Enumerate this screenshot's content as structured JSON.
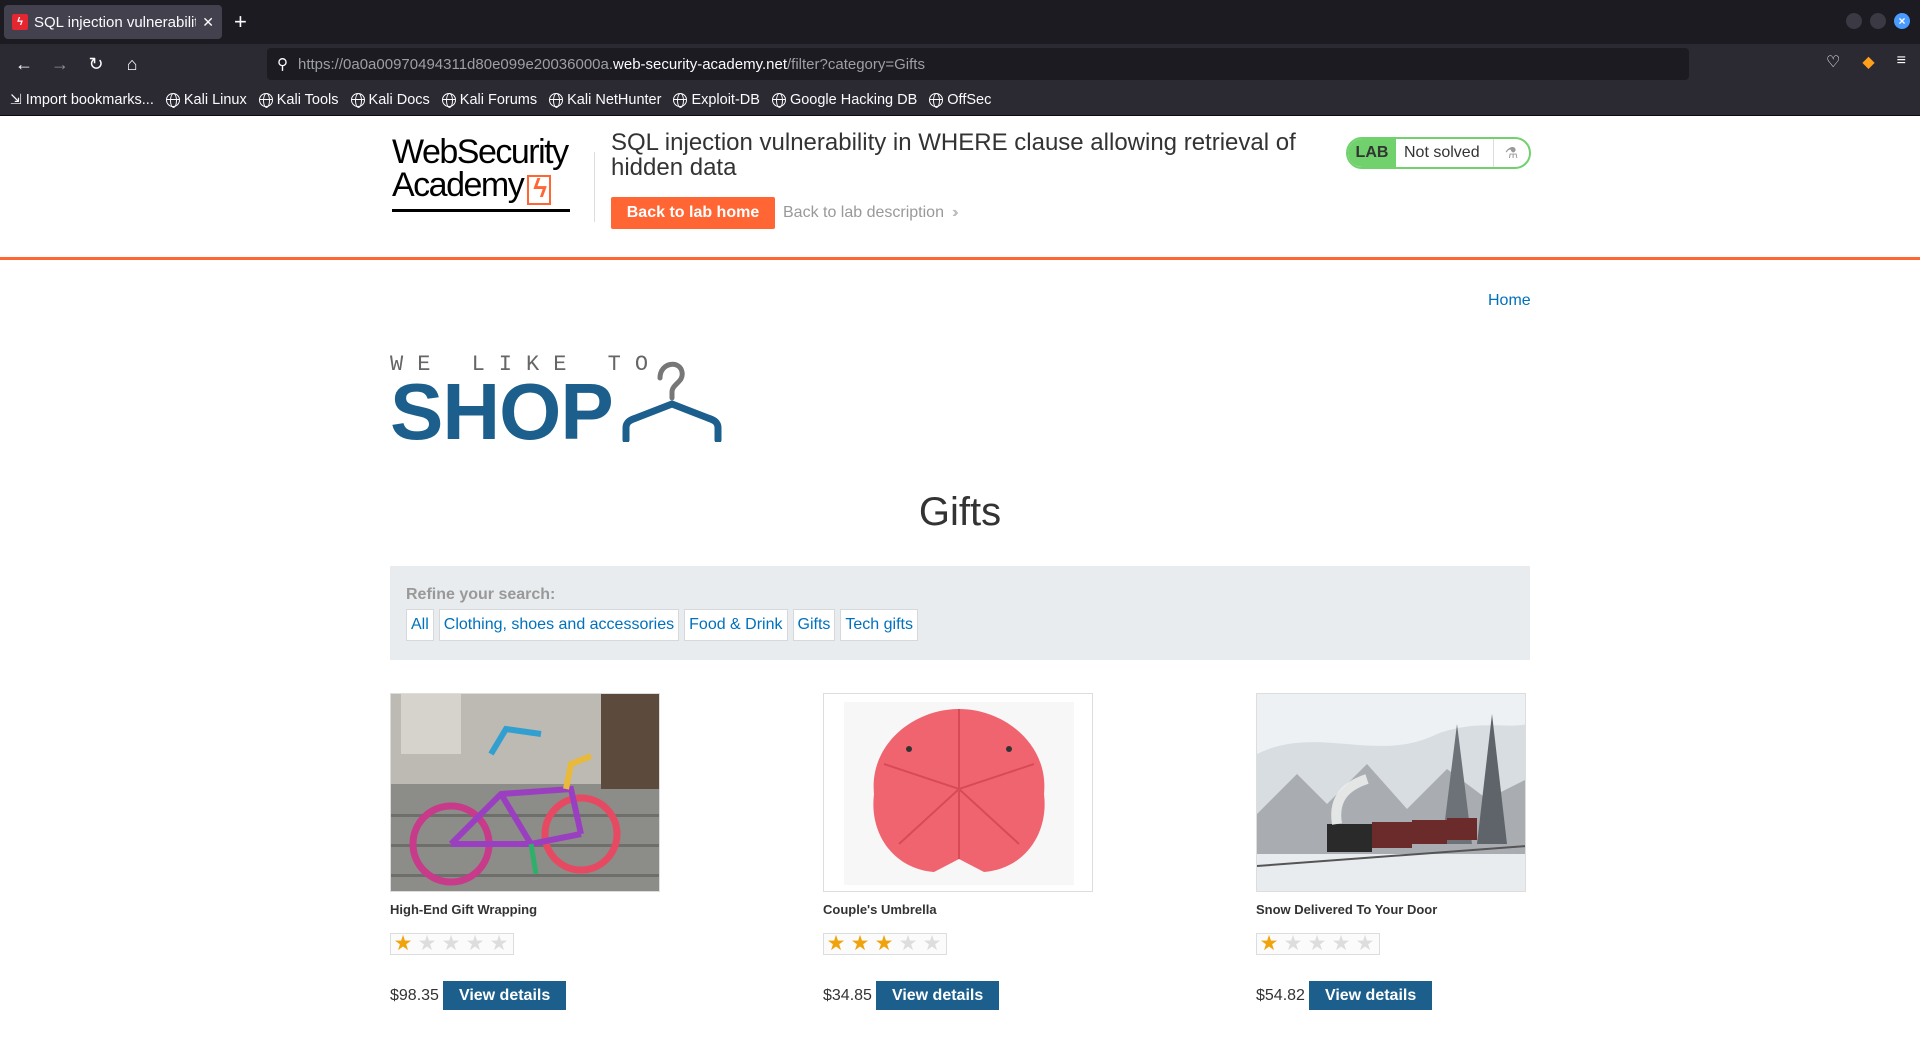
{
  "browser": {
    "tab_title": "SQL injection vulnerability",
    "url_prefix": "https://0a0a00970494311d80e099e20036000a.",
    "url_domain": "web-security-academy.net",
    "url_path": "/filter?category=Gifts",
    "bookmarks": [
      "Import bookmarks...",
      "Kali Linux",
      "Kali Tools",
      "Kali Docs",
      "Kali Forums",
      "Kali NetHunter",
      "Exploit-DB",
      "Google Hacking DB",
      "OffSec"
    ]
  },
  "lab": {
    "logo_line1": "WebSecurity",
    "logo_line2": "Academy",
    "title": "SQL injection vulnerability in WHERE clause allowing retrieval of hidden data",
    "back_home": "Back to lab home",
    "back_desc": "Back to lab description",
    "badge": "LAB",
    "status": "Not solved",
    "accent": "#ff6633",
    "status_color": "#70d16d"
  },
  "shop": {
    "home_link": "Home",
    "logo_small": "WE LIKE TO",
    "logo_big": "SHOP",
    "category_title": "Gifts",
    "refine_label": "Refine your search:",
    "filters": [
      "All",
      "Clothing, shoes and accessories",
      "Food & Drink",
      "Gifts",
      "Tech gifts"
    ],
    "brand_color": "#1c5f8c",
    "products": [
      {
        "name": "High-End Gift Wrapping",
        "rating": 1,
        "price": "$98.35",
        "button": "View details",
        "image": "knitted-bike-image"
      },
      {
        "name": "Couple's Umbrella",
        "rating": 3,
        "price": "$34.85",
        "button": "View details",
        "image": "red-umbrella-image"
      },
      {
        "name": "Snow Delivered To Your Door",
        "rating": 1,
        "price": "$54.82",
        "button": "View details",
        "image": "snowy-train-image"
      }
    ]
  }
}
